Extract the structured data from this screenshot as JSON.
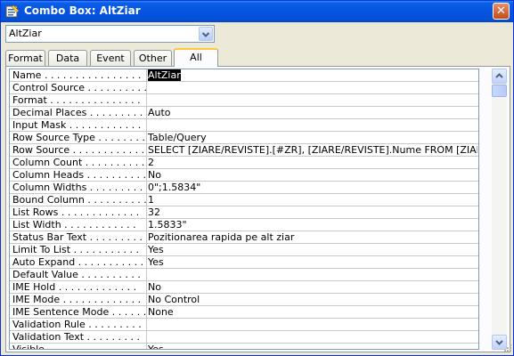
{
  "window": {
    "title": "Combo Box: AltZiar"
  },
  "selector": {
    "value": "AltZiar"
  },
  "tabs": [
    {
      "label": "Format"
    },
    {
      "label": "Data"
    },
    {
      "label": "Event"
    },
    {
      "label": "Other"
    },
    {
      "label": "All",
      "active": true
    }
  ],
  "properties": [
    {
      "name": "Name . . . . . . . . . . . . . . . .",
      "value": "AltZiar",
      "selected": true
    },
    {
      "name": "Control Source . . . . . . . . . .",
      "value": ""
    },
    {
      "name": "Format . . . . . . . . . . . . . . .",
      "value": ""
    },
    {
      "name": "Decimal Places . . . . . . . . . .",
      "value": "Auto"
    },
    {
      "name": "Input Mask . . . . . . . . . . . .",
      "value": ""
    },
    {
      "name": "Row Source Type . . . . . . . . .",
      "value": "Table/Query"
    },
    {
      "name": "Row Source . . . . . . . . . . . .",
      "value": "SELECT [ZIARE/REVISTE].[#ZR], [ZIARE/REVISTE].Nume FROM [ZIARE/R"
    },
    {
      "name": "Column Count . . . . . . . . . . .",
      "value": "2"
    },
    {
      "name": "Column Heads . . . . . . . . . . .",
      "value": "No"
    },
    {
      "name": "Column Widths . . . . . . . . . .",
      "value": "0\";1.5834\""
    },
    {
      "name": "Bound Column . . . . . . . . . . .",
      "value": "1"
    },
    {
      "name": "List Rows . . . . . . . . . . . . .",
      "value": "32"
    },
    {
      "name": "List Width . . . . . . . . . . . .",
      "value": "1.5833\""
    },
    {
      "name": "Status Bar Text . . . . . . . . .",
      "value": "Pozitionarea rapida pe alt ziar"
    },
    {
      "name": "Limit To List . . . . . . . . . . .",
      "value": "Yes"
    },
    {
      "name": "Auto Expand . . . . . . . . . . .",
      "value": "Yes"
    },
    {
      "name": "Default Value . . . . . . . . . .",
      "value": ""
    },
    {
      "name": "IME Hold . . . . . . . . . . . . .",
      "value": "No"
    },
    {
      "name": "IME Mode . . . . . . . . . . . . .",
      "value": "No Control"
    },
    {
      "name": "IME Sentence Mode . . . . . . . .",
      "value": "None"
    },
    {
      "name": "Validation Rule . . . . . . . . .",
      "value": ""
    },
    {
      "name": "Validation Text . . . . . . . . .",
      "value": ""
    },
    {
      "name": "Visible . . . . . . . . . . . . . .",
      "value": "Yes"
    }
  ],
  "icons": {
    "title": "properties-icon",
    "close": "close-icon",
    "dropdown": "chevron-down-icon"
  }
}
